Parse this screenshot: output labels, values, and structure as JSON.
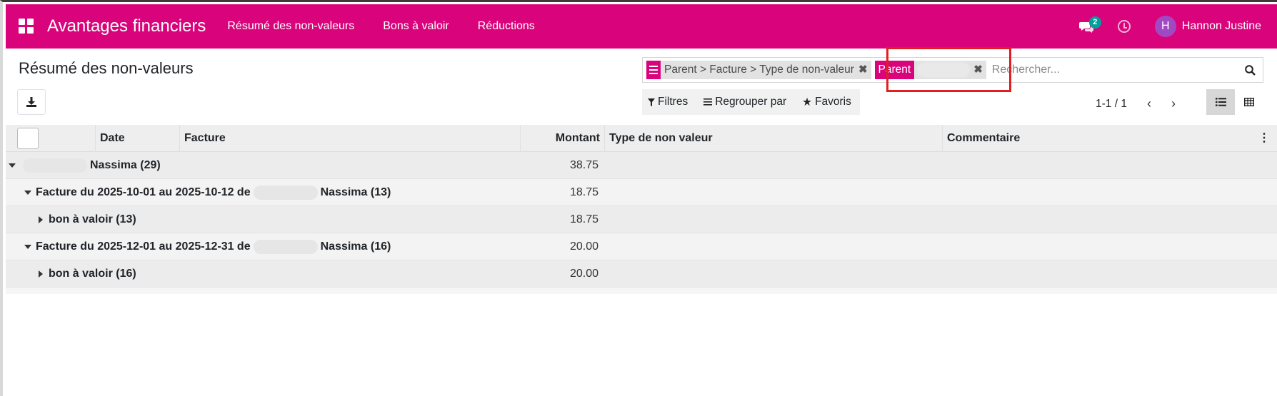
{
  "navbar": {
    "app_title": "Avantages financiers",
    "menu": [
      "Résumé des non-valeurs",
      "Bons à valoir",
      "Réductions"
    ],
    "messages_count": "2",
    "user_initial": "H",
    "user_name": "Hannon Justine",
    "accent_color": "#d9047c"
  },
  "page": {
    "title": "Résumé des non-valeurs"
  },
  "search": {
    "facets": [
      {
        "label": "",
        "value": "Parent > Facture > Type de non-valeur"
      },
      {
        "label": "Parent",
        "value": ""
      }
    ],
    "placeholder": "Rechercher..."
  },
  "filters": {
    "filters_label": "Filtres",
    "group_by_label": "Regrouper par",
    "favorites_label": "Favoris"
  },
  "pager": {
    "value": "1-1 / 1"
  },
  "table": {
    "columns": {
      "date": "Date",
      "facture": "Facture",
      "montant": "Montant",
      "type": "Type de non valeur",
      "commentaire": "Commentaire"
    },
    "rows": [
      {
        "level": 0,
        "expanded": true,
        "label": "Nassima (29)",
        "amount": "38.75"
      },
      {
        "level": 1,
        "expanded": true,
        "label_pre": "Facture du 2025-10-01 au 2025-10-12 de",
        "label_post": "Nassima (13)",
        "amount": "18.75"
      },
      {
        "level": 2,
        "expanded": false,
        "label": "bon à valoir (13)",
        "amount": "18.75"
      },
      {
        "level": 1,
        "expanded": true,
        "label_pre": "Facture du 2025-12-01 au 2025-12-31 de",
        "label_post": "Nassima (16)",
        "amount": "20.00"
      },
      {
        "level": 2,
        "expanded": false,
        "label": "bon à valoir (16)",
        "amount": "20.00"
      }
    ]
  }
}
